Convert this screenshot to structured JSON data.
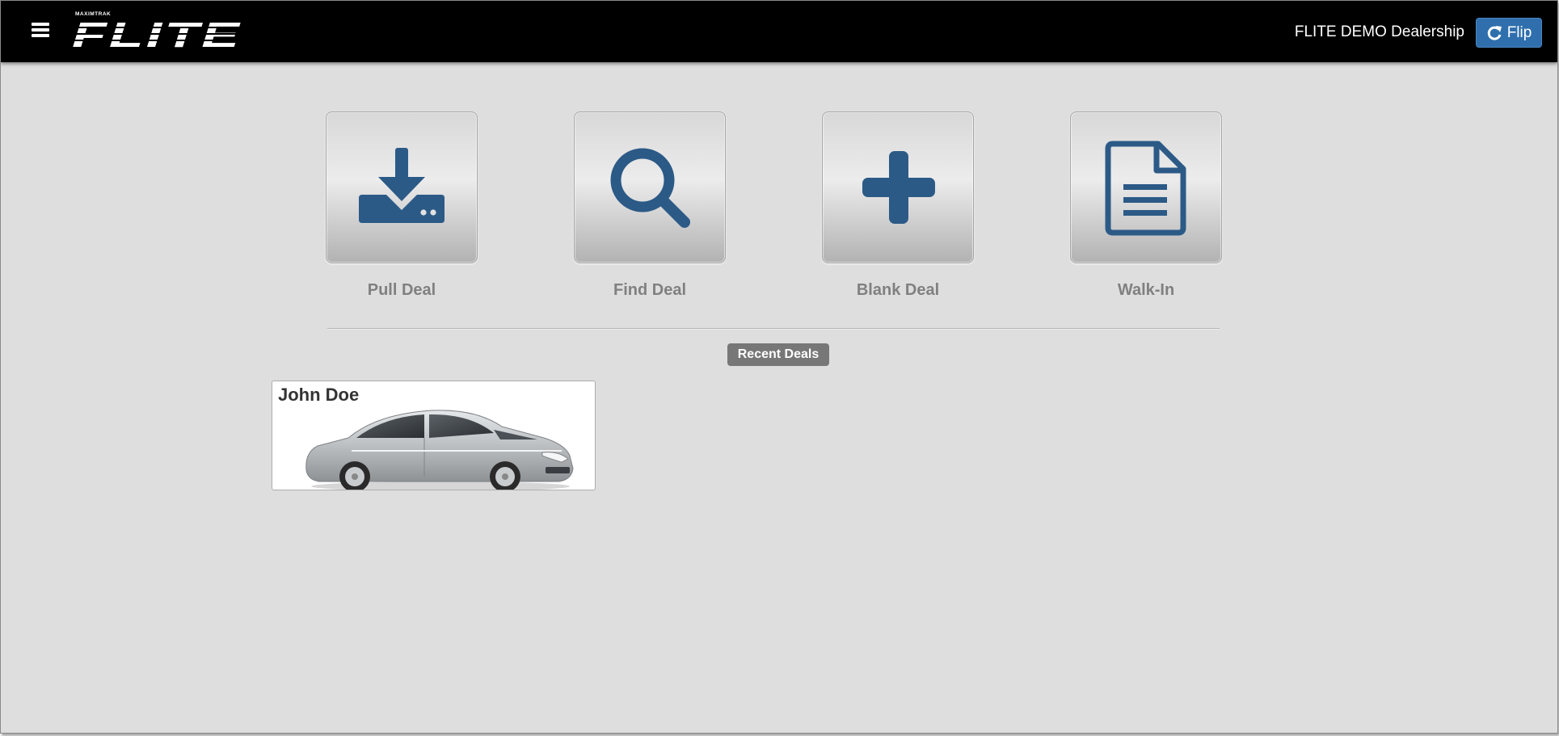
{
  "header": {
    "logo_text": "FLITE",
    "logo_subtext": "MAXIMTRAK",
    "dealership": "FLITE DEMO Dealership",
    "flip_label": "Flip"
  },
  "actions": [
    {
      "label": "Pull Deal",
      "icon": "download-icon"
    },
    {
      "label": "Find Deal",
      "icon": "search-icon"
    },
    {
      "label": "Blank Deal",
      "icon": "plus-icon"
    },
    {
      "label": "Walk-In",
      "icon": "document-icon"
    }
  ],
  "recent": {
    "title": "Recent Deals",
    "deals": [
      {
        "name": "John Doe",
        "image": "silver-sedan"
      }
    ]
  },
  "colors": {
    "navbar": "#000000",
    "background": "#dedede",
    "icon_blue": "#2c5a87",
    "flip_button": "#2f6fad",
    "label_gray": "#808080",
    "badge": "#777777"
  }
}
